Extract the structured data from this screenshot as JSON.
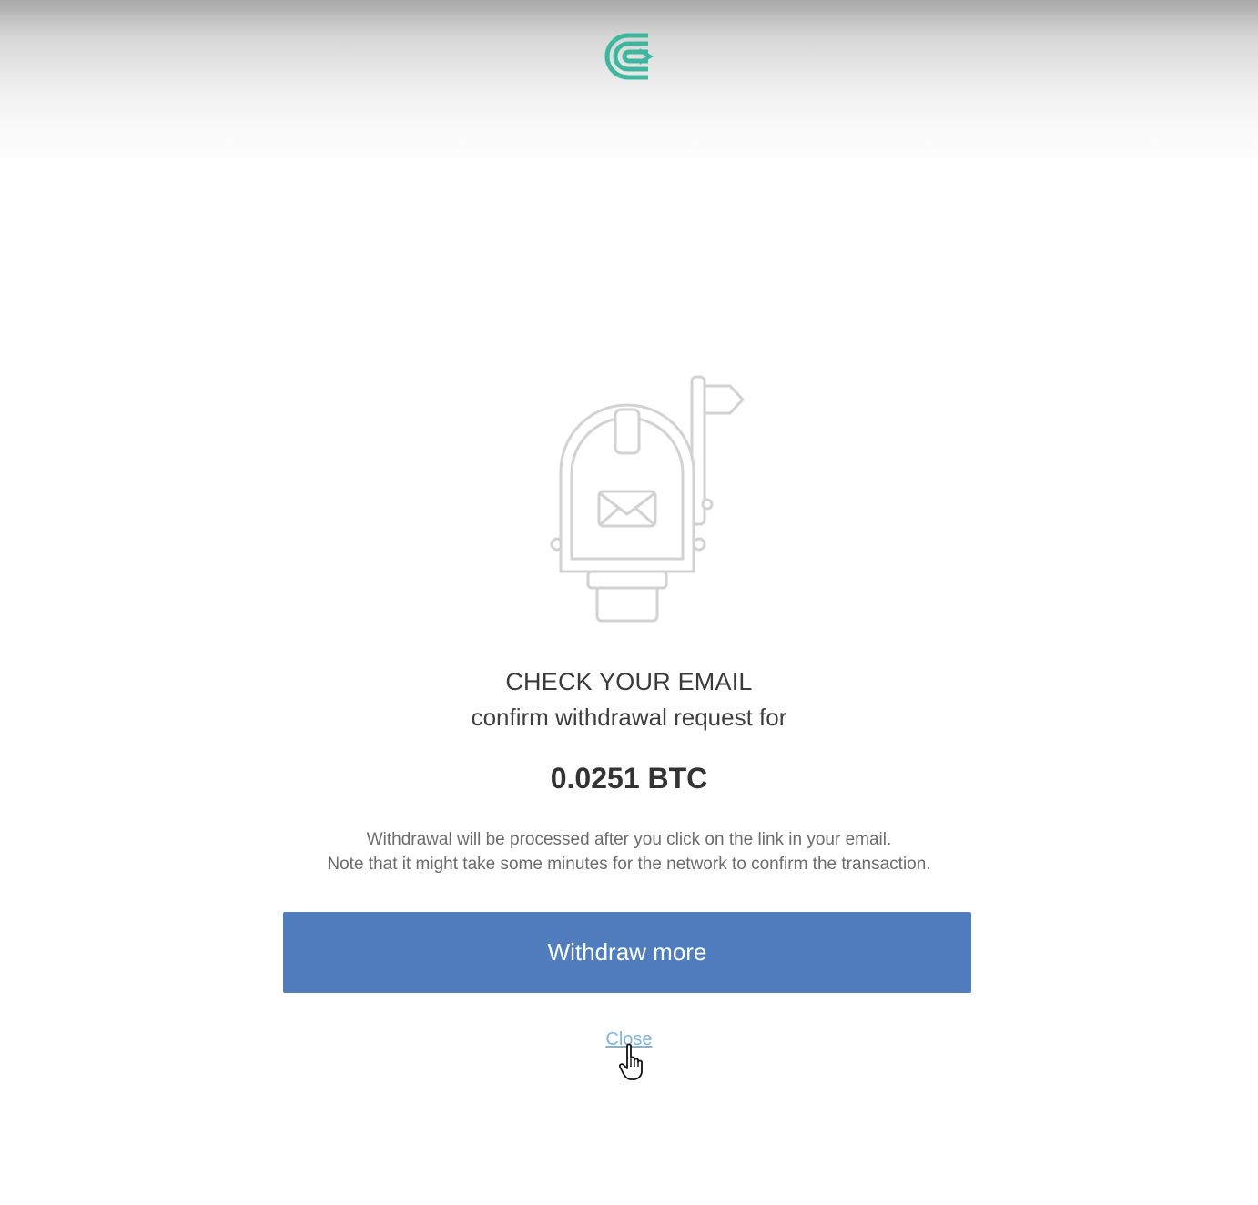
{
  "header": {
    "logo_icon": "cex-logo-icon",
    "logo_color": "#3fb7a0"
  },
  "illustration": {
    "icon": "mailbox-icon"
  },
  "confirmation": {
    "title": "CHECK YOUR EMAIL",
    "subtitle": "confirm withdrawal request for",
    "amount": "0.0251 BTC",
    "note_line_1": "Withdrawal will be processed after you click on the link in your email.",
    "note_line_2": "Note that it might take some minutes for the network to confirm the transaction."
  },
  "actions": {
    "withdraw_more_label": "Withdraw more",
    "withdraw_more_color": "#4f7dbe",
    "close_label": "Close",
    "close_color": "#7fb4df"
  },
  "pointer": {
    "icon": "hand-pointer-icon"
  }
}
